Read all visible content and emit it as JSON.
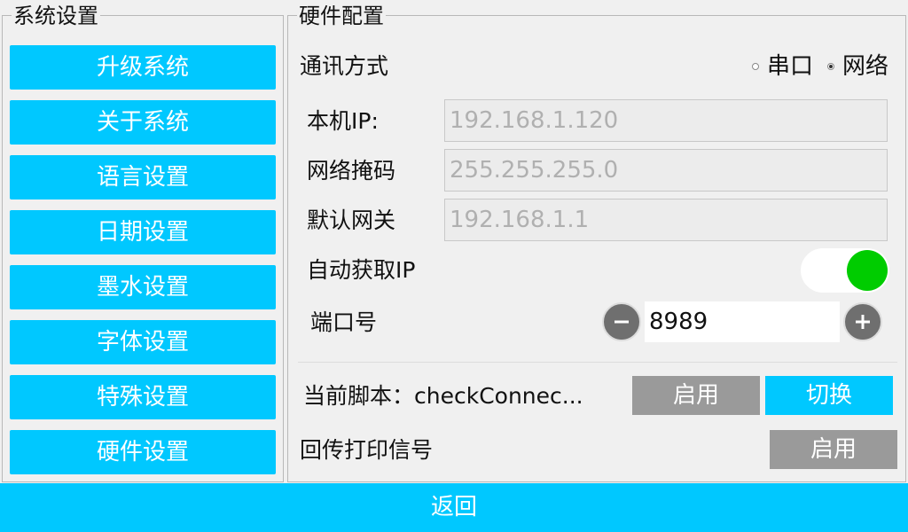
{
  "system_panel": {
    "title": "系统设置",
    "buttons": [
      "升级系统",
      "关于系统",
      "语言设置",
      "日期设置",
      "墨水设置",
      "字体设置",
      "特殊设置",
      "硬件设置"
    ]
  },
  "hardware_panel": {
    "title": "硬件配置",
    "comm_mode": {
      "label": "通讯方式",
      "options": [
        {
          "label": "串口",
          "checked": false
        },
        {
          "label": "网络",
          "checked": true
        }
      ]
    },
    "local_ip": {
      "label": "本机IP:",
      "value": "192.168.1.120"
    },
    "netmask": {
      "label": "网络掩码",
      "value": "255.255.255.0"
    },
    "gateway": {
      "label": "默认网关",
      "value": "192.168.1.1"
    },
    "auto_ip": {
      "label": "自动获取IP",
      "enabled": true,
      "on_color": "#00cc00"
    },
    "port": {
      "label": "端口号",
      "value": "8989"
    },
    "script": {
      "label": "当前脚本：checkConnec...",
      "enable_label": "启用",
      "switch_label": "切换"
    },
    "print_signal": {
      "label": "回传打印信号",
      "enable_label": "启用"
    }
  },
  "footer": {
    "back_label": "返回"
  },
  "colors": {
    "accent": "#00c8ff",
    "disabled_button": "#9a9a9a",
    "toggle_on": "#00cc00"
  }
}
